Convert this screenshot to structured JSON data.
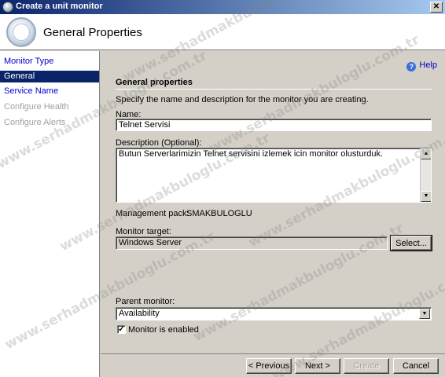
{
  "window": {
    "title": "Create a unit monitor",
    "close_glyph": "✕"
  },
  "header": {
    "title": "General Properties",
    "icon": "monitor-wizard-icon"
  },
  "nav": [
    {
      "label": "Monitor Type",
      "state": "link"
    },
    {
      "label": "General",
      "state": "selected"
    },
    {
      "label": "Service Name",
      "state": "link"
    },
    {
      "label": "Configure Health",
      "state": "disabled"
    },
    {
      "label": "Configure Alerts",
      "state": "disabled"
    }
  ],
  "help": {
    "label": "Help",
    "icon": "help-icon"
  },
  "form": {
    "section_title": "General properties",
    "description_text": "Specify the name and description for the monitor you are creating.",
    "name_label": "Name:",
    "name_value": "Telnet Servisi",
    "description_label": "Description (Optional):",
    "description_value": "Butun Serverlarimizin Telnet servisini izlemek icin monitor olusturduk.",
    "management_pack_label": "Management pack:",
    "management_pack_value": "SMAKBULOGLU",
    "monitor_target_label": "Monitor target:",
    "monitor_target_value": "Windows Server",
    "select_button": "Select...",
    "parent_monitor_label": "Parent monitor:",
    "parent_monitor_value": "Availability",
    "enabled_label": "Monitor is enabled",
    "enabled_checked": true
  },
  "buttons": {
    "previous": "< Previous",
    "next": "Next >",
    "create": "Create",
    "cancel": "Cancel"
  },
  "watermark": {
    "text": "www.serhadmakbuloglu.com.tr"
  },
  "colors": {
    "title_bar": "#0a246a",
    "selection": "#0a246a",
    "link": "#0000cc",
    "dialog_bg": "#d4d0c8"
  }
}
